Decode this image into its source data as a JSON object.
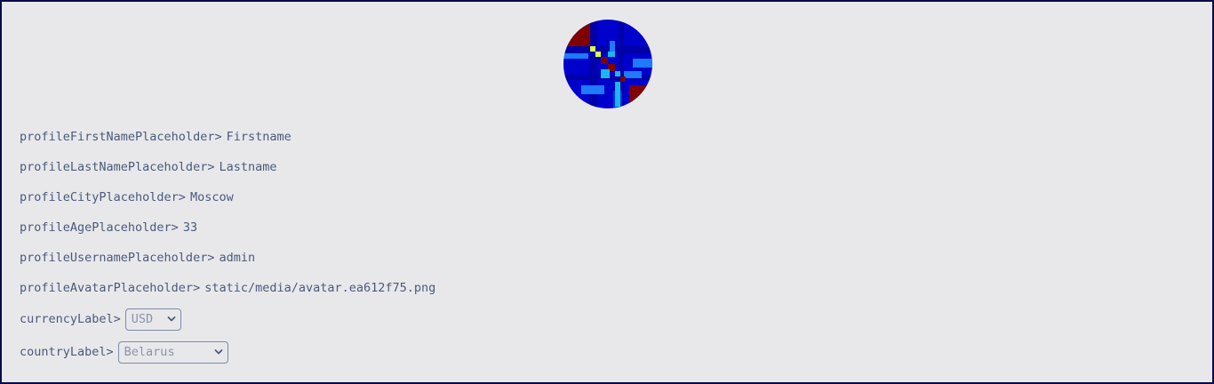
{
  "profile": {
    "fields": [
      {
        "label": "profileFirstNamePlaceholder>",
        "value": "Firstname"
      },
      {
        "label": "profileLastNamePlaceholder>",
        "value": "Lastname"
      },
      {
        "label": "profileCityPlaceholder>",
        "value": "Moscow"
      },
      {
        "label": "profileAgePlaceholder>",
        "value": "33"
      },
      {
        "label": "profileUsernamePlaceholder>",
        "value": "admin"
      },
      {
        "label": "profileAvatarPlaceholder>",
        "value": "static/media/avatar.ea612f75.png"
      }
    ],
    "currency": {
      "label": "currencyLabel>",
      "selected": "USD"
    },
    "country": {
      "label": "countryLabel>",
      "selected": "Belarus"
    }
  },
  "colors": {
    "background": "#e8e8eb",
    "border": "#0b0b4a",
    "text": "#4a5a7a",
    "select_text": "#8a93aa",
    "avatar_dark_red": "#800000",
    "avatar_blue": "#0000cc",
    "avatar_light_blue": "#1e7bff",
    "avatar_cyan": "#19b8f0",
    "avatar_yellow": "#d9ff4d"
  },
  "icons": {
    "select_chevron": "chevron-down-icon",
    "avatar": "avatar-image"
  }
}
